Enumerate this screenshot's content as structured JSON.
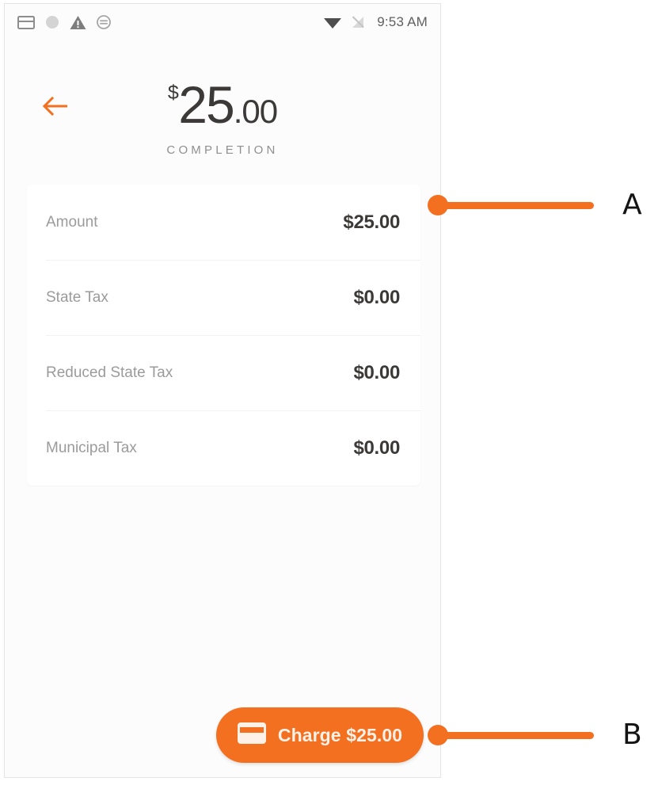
{
  "status_bar": {
    "icons_left": [
      "card-icon",
      "circle-icon",
      "warning-triangle-icon",
      "sync-circle-icon"
    ],
    "icons_right": [
      "wifi-icon",
      "cellular-off-icon"
    ],
    "time": "9:53 AM"
  },
  "header": {
    "back_icon": "back-arrow-icon",
    "currency_symbol": "$",
    "amount_whole": "25",
    "amount_cents": ".00",
    "subtitle": "COMPLETION"
  },
  "detail_card": {
    "rows": [
      {
        "label": "Amount",
        "value": "$25.00"
      },
      {
        "label": "State Tax",
        "value": "$0.00"
      },
      {
        "label": "Reduced State Tax",
        "value": "$0.00"
      },
      {
        "label": "Municipal Tax",
        "value": "$0.00"
      }
    ]
  },
  "charge_button": {
    "icon": "credit-card-icon",
    "label": "Charge $25.00"
  },
  "annotations": [
    {
      "id": "A",
      "label": "A",
      "target": "detail-card"
    },
    {
      "id": "B",
      "label": "B",
      "target": "charge-button"
    }
  ],
  "colors": {
    "accent": "#f37021",
    "text_primary": "#3c3a38",
    "text_muted": "#9b9b9b",
    "page_bg": "#fcfcfc",
    "card_bg": "#ffffff"
  }
}
